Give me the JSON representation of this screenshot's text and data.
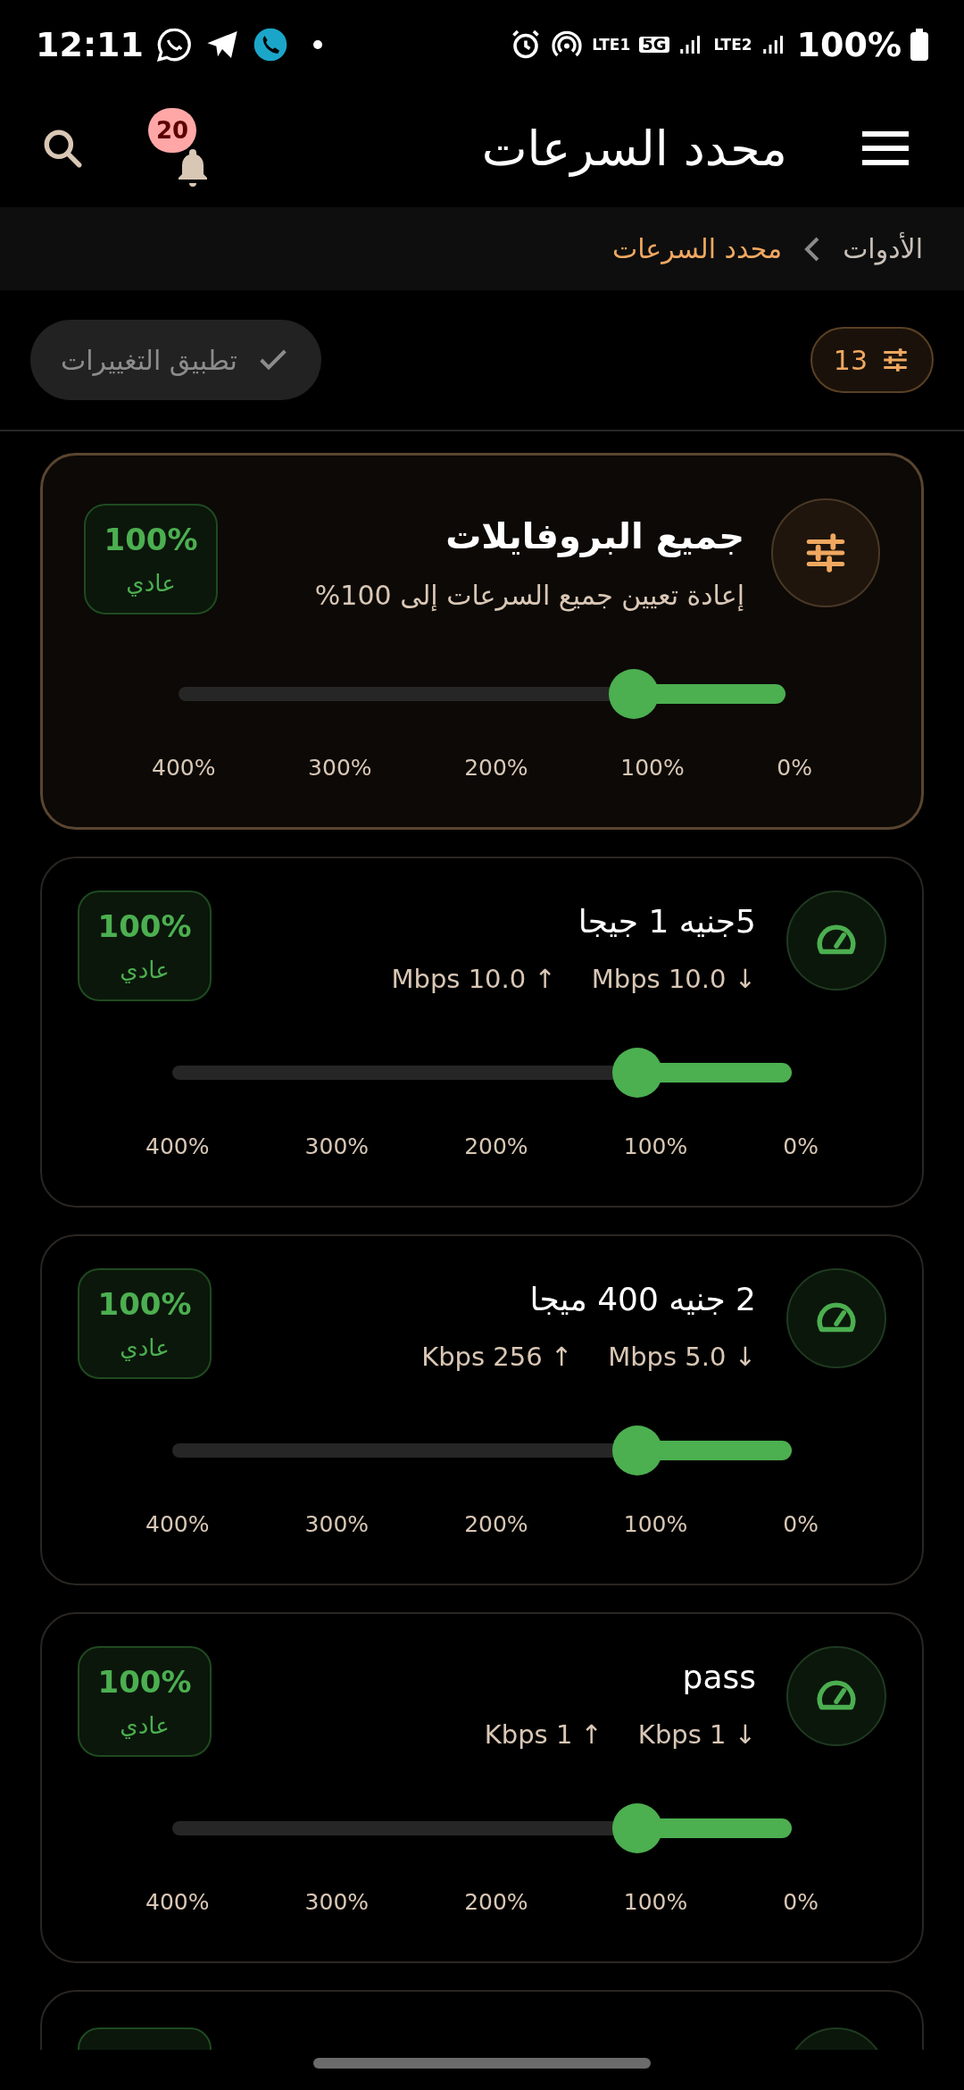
{
  "status_bar": {
    "time": "12:11",
    "sim1": "LTE1",
    "network": "5G",
    "sim2": "LTE2",
    "battery": "100%"
  },
  "header": {
    "title": "محدد السرعات",
    "notification_count": "20"
  },
  "breadcrumb": [
    {
      "label": "الأدوات",
      "current": false
    },
    {
      "label": "محدد السرعات",
      "current": true
    }
  ],
  "toolbar": {
    "apply_button": {
      "label": "تطبيق التغييرات",
      "disabled": true
    },
    "filter_count": "13"
  },
  "all_profiles": {
    "title": "جميع البروفايلات",
    "subtitle": "إعادة تعيين جميع السرعات إلى 100%",
    "badge_value": "100%",
    "badge_label": "عادي",
    "level": 0.25,
    "scale": [
      "400%",
      "300%",
      "200%",
      "100%",
      "0%"
    ]
  },
  "profiles": [
    {
      "name": "5جنيه 1 جيجا",
      "download": "Mbps 10.0 ↓",
      "upload": "Mbps 10.0 ↑",
      "badge_value": "100%",
      "badge_label": "عادي",
      "level": 0.25,
      "scale": [
        "400%",
        "300%",
        "200%",
        "100%",
        "0%"
      ]
    },
    {
      "name": "2 جنيه 400 ميجا",
      "download": "Mbps 5.0 ↓",
      "upload": "Kbps 256 ↑",
      "badge_value": "100%",
      "badge_label": "عادي",
      "level": 0.25,
      "scale": [
        "400%",
        "300%",
        "200%",
        "100%",
        "0%"
      ]
    },
    {
      "name": "pass",
      "download": "Kbps 1 ↓",
      "upload": "Kbps 1 ↑",
      "badge_value": "100%",
      "badge_label": "عادي",
      "level": 0.25,
      "scale": [
        "400%",
        "300%",
        "200%",
        "100%",
        "0%"
      ]
    }
  ],
  "more_below": true
}
